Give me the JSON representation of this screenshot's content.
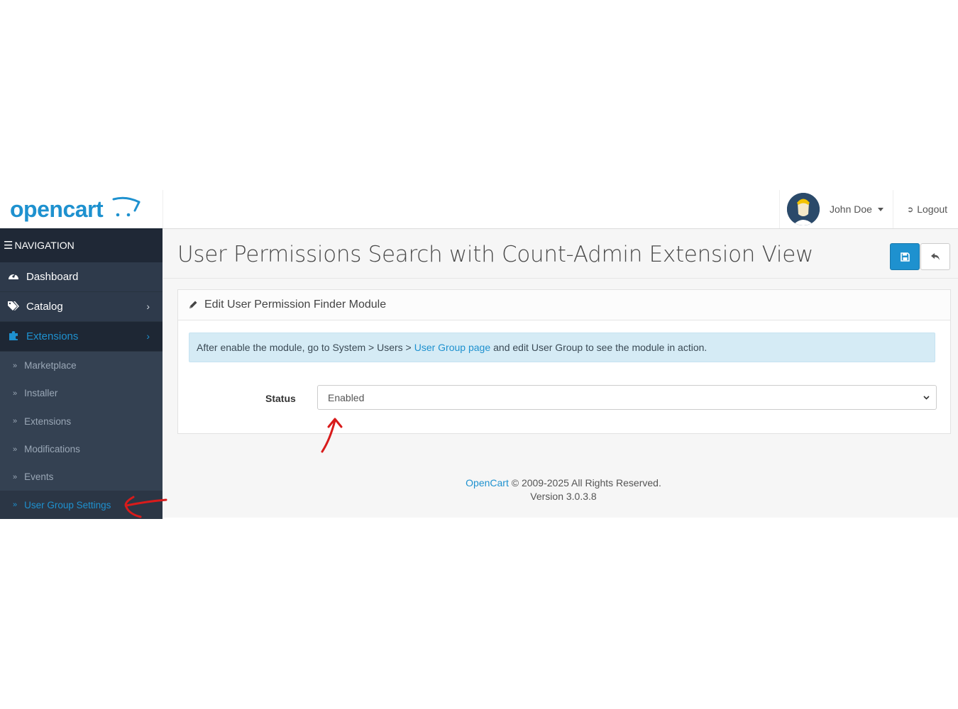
{
  "brand": {
    "logo_text": "opencart"
  },
  "header": {
    "user_name": "John Doe",
    "logout_label": "Logout"
  },
  "sidebar": {
    "heading": "NAVIGATION",
    "items": [
      {
        "label": "Dashboard",
        "icon": "dashboard-icon"
      },
      {
        "label": "Catalog",
        "icon": "tags-icon"
      },
      {
        "label": "Extensions",
        "icon": "puzzle-icon",
        "active": true
      }
    ],
    "sub_items": [
      {
        "label": "Marketplace"
      },
      {
        "label": "Installer"
      },
      {
        "label": "Extensions"
      },
      {
        "label": "Modifications"
      },
      {
        "label": "Events"
      },
      {
        "label": "User Group Settings",
        "active": true
      }
    ]
  },
  "page": {
    "title": "User Permissions Search with Count-Admin Extension View",
    "panel_title": "Edit User Permission Finder Module",
    "alert": {
      "before": "After enable the module, go to System > Users >",
      "link": "User Group page",
      "after": "and edit User Group to see the module in action."
    },
    "status_label": "Status",
    "status_value": "Enabled"
  },
  "footer": {
    "link": "OpenCart",
    "copyright": "© 2009-2025 All Rights Reserved.",
    "version": "Version 3.0.3.8"
  },
  "colors": {
    "accent": "#1e91cf",
    "sidebar_bg": "#2e3a4b",
    "annotation": "#d81b1b"
  }
}
